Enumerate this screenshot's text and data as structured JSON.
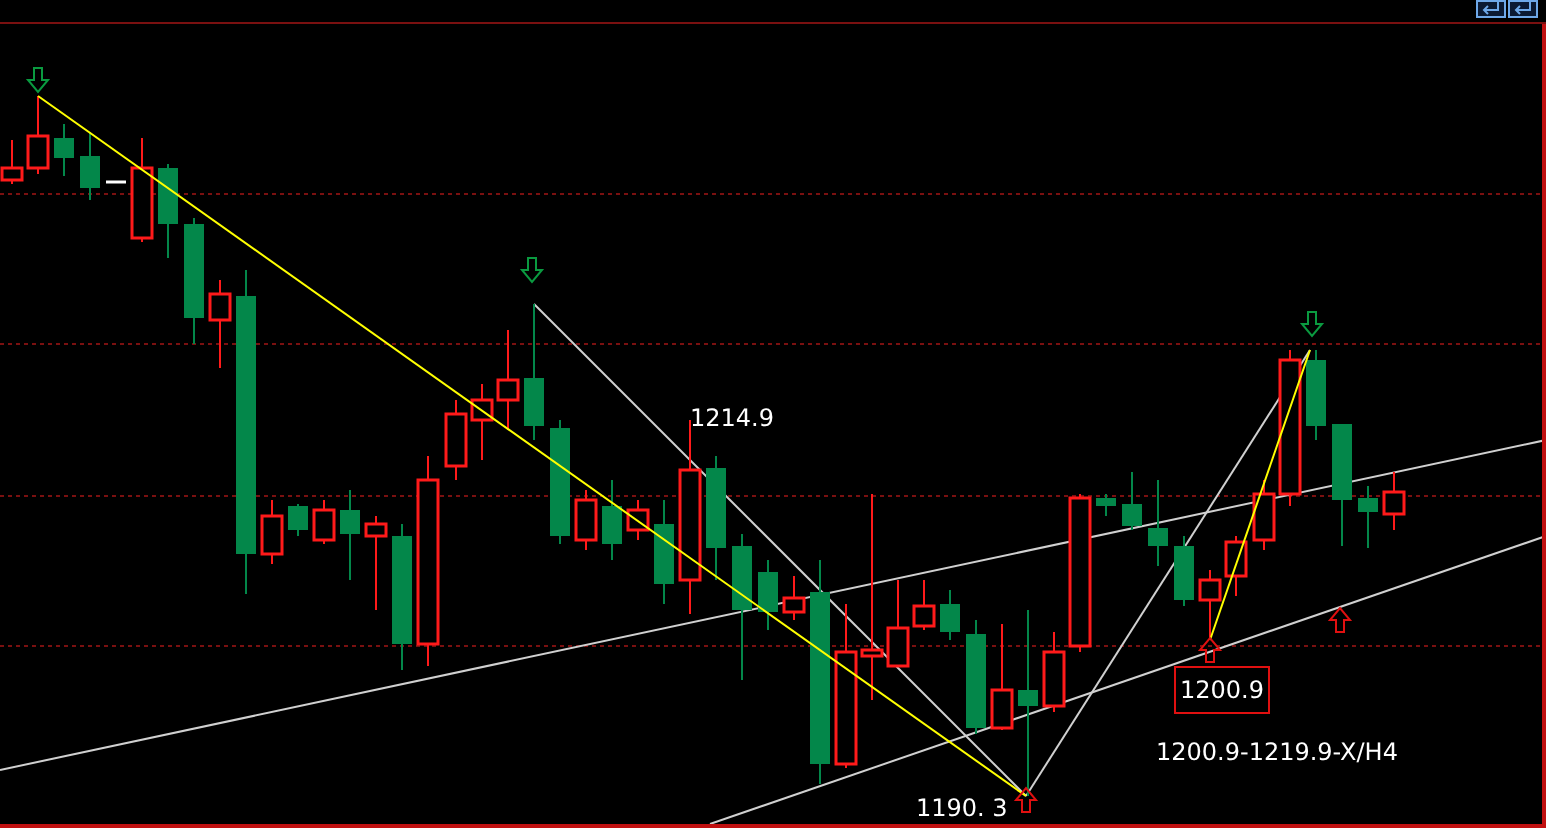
{
  "chart": {
    "labels": [
      {
        "kind": "plain",
        "text": "1214.9"
      },
      {
        "kind": "plain",
        "text": "1190. 3"
      },
      {
        "kind": "boxed",
        "text": "1200.9"
      },
      {
        "kind": "plain",
        "text": "1200.9-1219.9-X/H4"
      }
    ]
  }
}
